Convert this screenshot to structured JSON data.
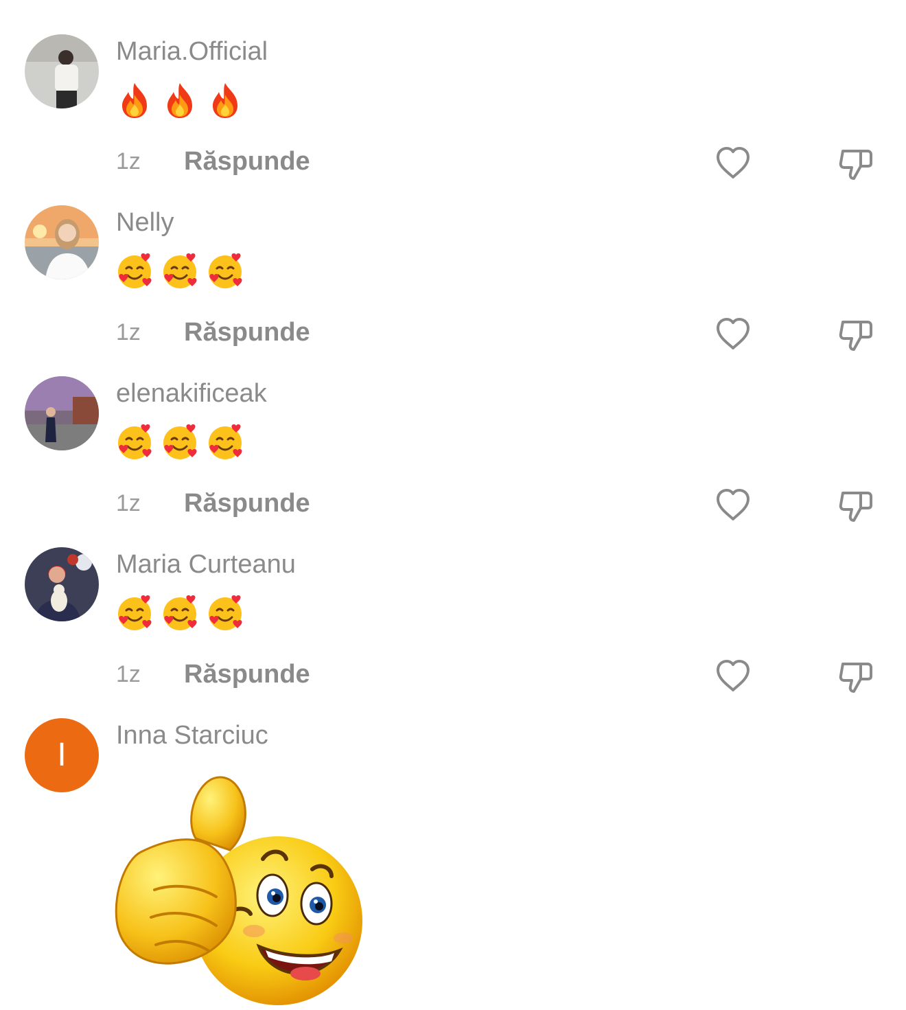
{
  "comments": [
    {
      "username": "Maria.Official",
      "content": [
        "fire-emoji",
        "fire-emoji",
        "fire-emoji"
      ],
      "time": "1z",
      "reply_label": "Răspunde"
    },
    {
      "username": "Nelly",
      "content": [
        "smiling-face-with-hearts-emoji",
        "smiling-face-with-hearts-emoji",
        "smiling-face-with-hearts-emoji"
      ],
      "time": "1z",
      "reply_label": "Răspunde"
    },
    {
      "username": "elenakificeak",
      "content": [
        "smiling-face-with-hearts-emoji",
        "smiling-face-with-hearts-emoji",
        "smiling-face-with-hearts-emoji"
      ],
      "time": "1z",
      "reply_label": "Răspunde"
    },
    {
      "username": "Maria Curteanu",
      "content": [
        "smiling-face-with-hearts-emoji",
        "smiling-face-with-hearts-emoji",
        "smiling-face-with-hearts-emoji"
      ],
      "time": "1z",
      "reply_label": "Răspunde"
    },
    {
      "username": "Inna Starciuc",
      "avatar_letter": "I",
      "avatar_color": "#ec6a12",
      "content": [
        "thumbs-up-smiley-sticker"
      ]
    }
  ],
  "icons": {
    "like": "heart-outline-icon",
    "dislike": "thumbs-down-outline-icon"
  },
  "colors": {
    "text": "#8a8a8a",
    "icon": "#8a8a8a",
    "avatar_letter_bg": "#ec6a12"
  }
}
